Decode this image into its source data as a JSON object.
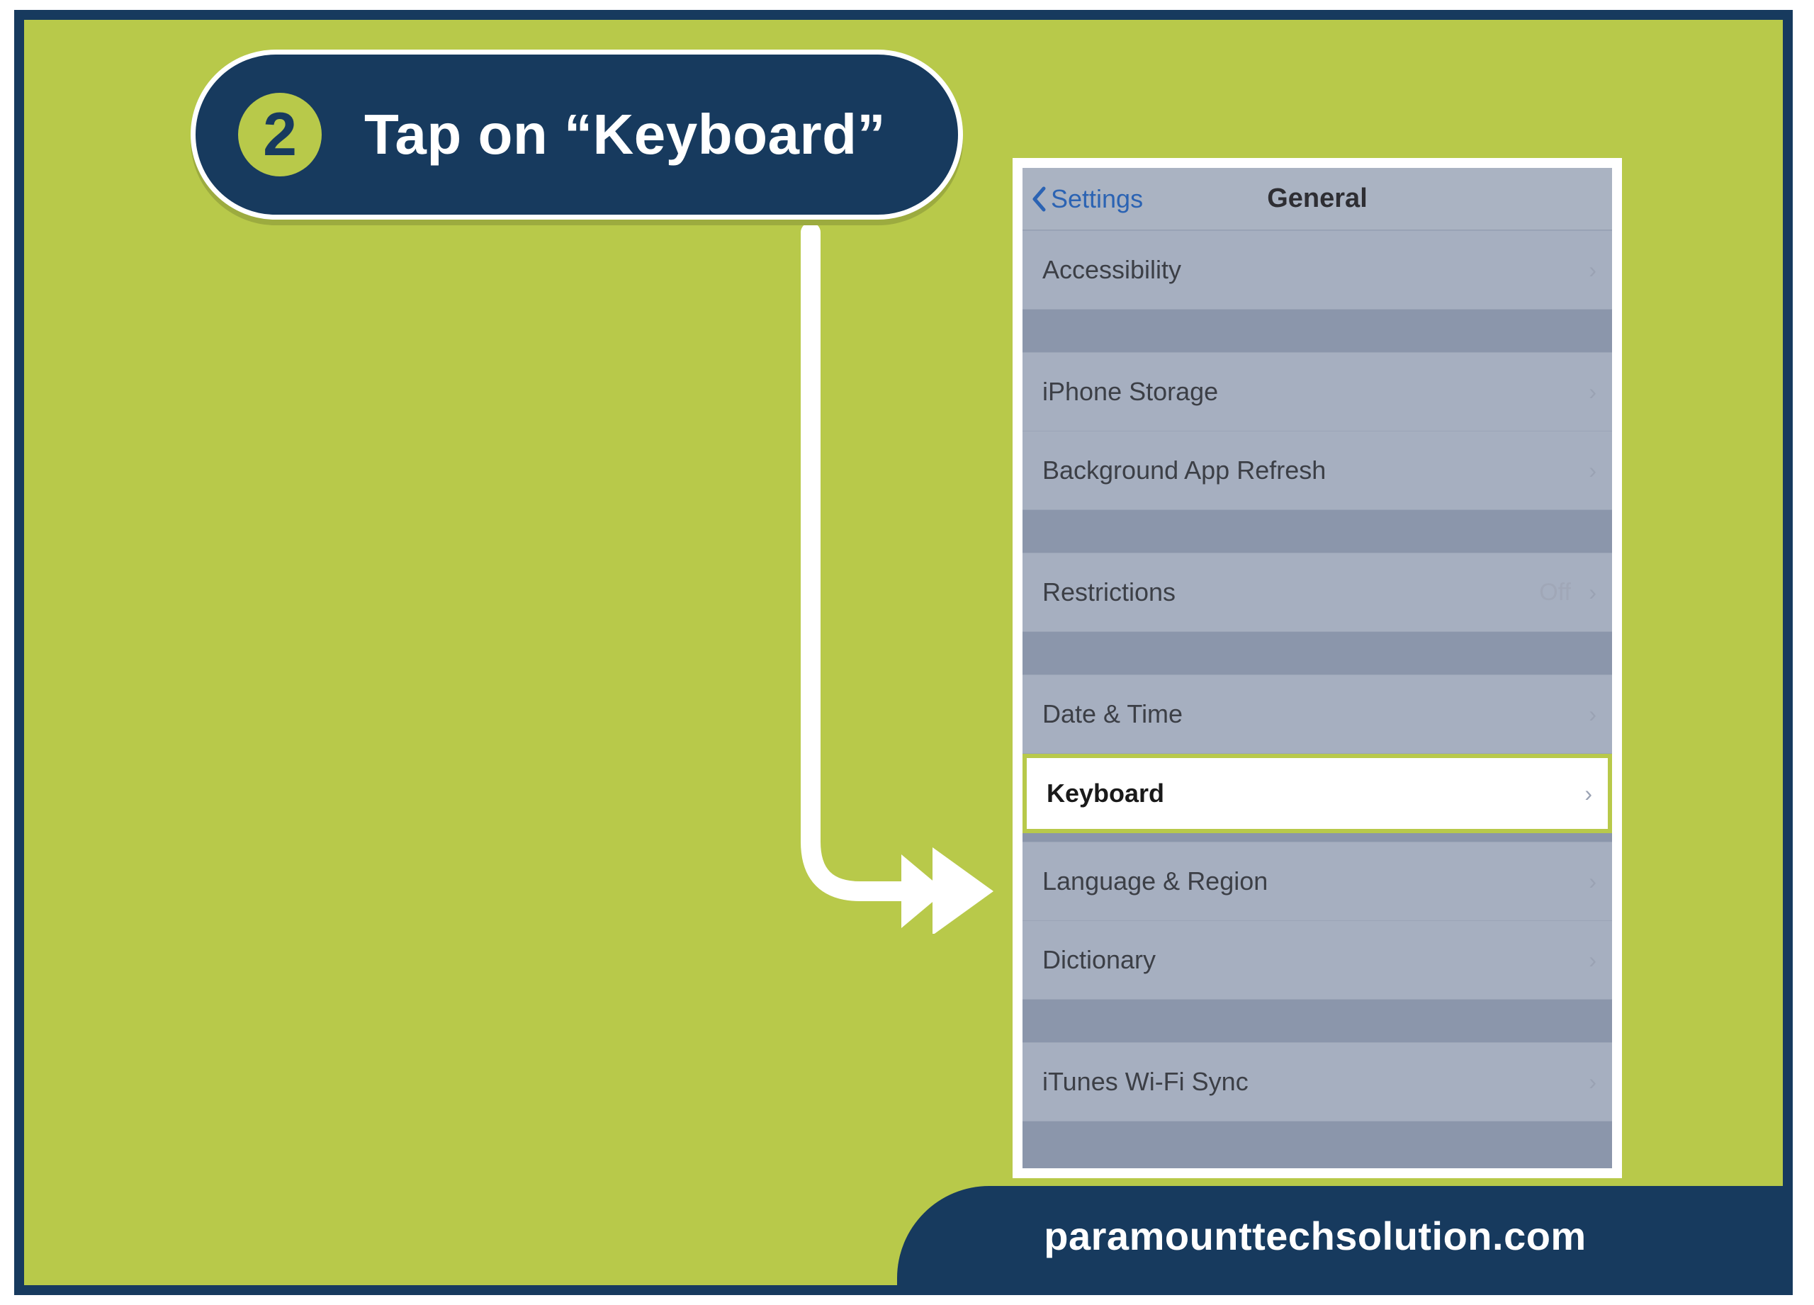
{
  "step": {
    "number": "2",
    "title": "Tap on “Keyboard”"
  },
  "phone": {
    "nav": {
      "back_label": "Settings",
      "title": "General"
    },
    "rows": {
      "accessibility": "Accessibility",
      "iphone_storage": "iPhone Storage",
      "background_app_refresh": "Background App Refresh",
      "restrictions": {
        "label": "Restrictions",
        "value": "Off"
      },
      "date_time": "Date & Time",
      "keyboard": "Keyboard",
      "language_region": "Language & Region",
      "dictionary": "Dictionary",
      "itunes_wifi_sync": "iTunes Wi-Fi Sync"
    }
  },
  "footer": {
    "site": "paramounttechsolution.com"
  },
  "colors": {
    "brand_navy": "#173a5e",
    "brand_chartreuse": "#b8c94a"
  }
}
